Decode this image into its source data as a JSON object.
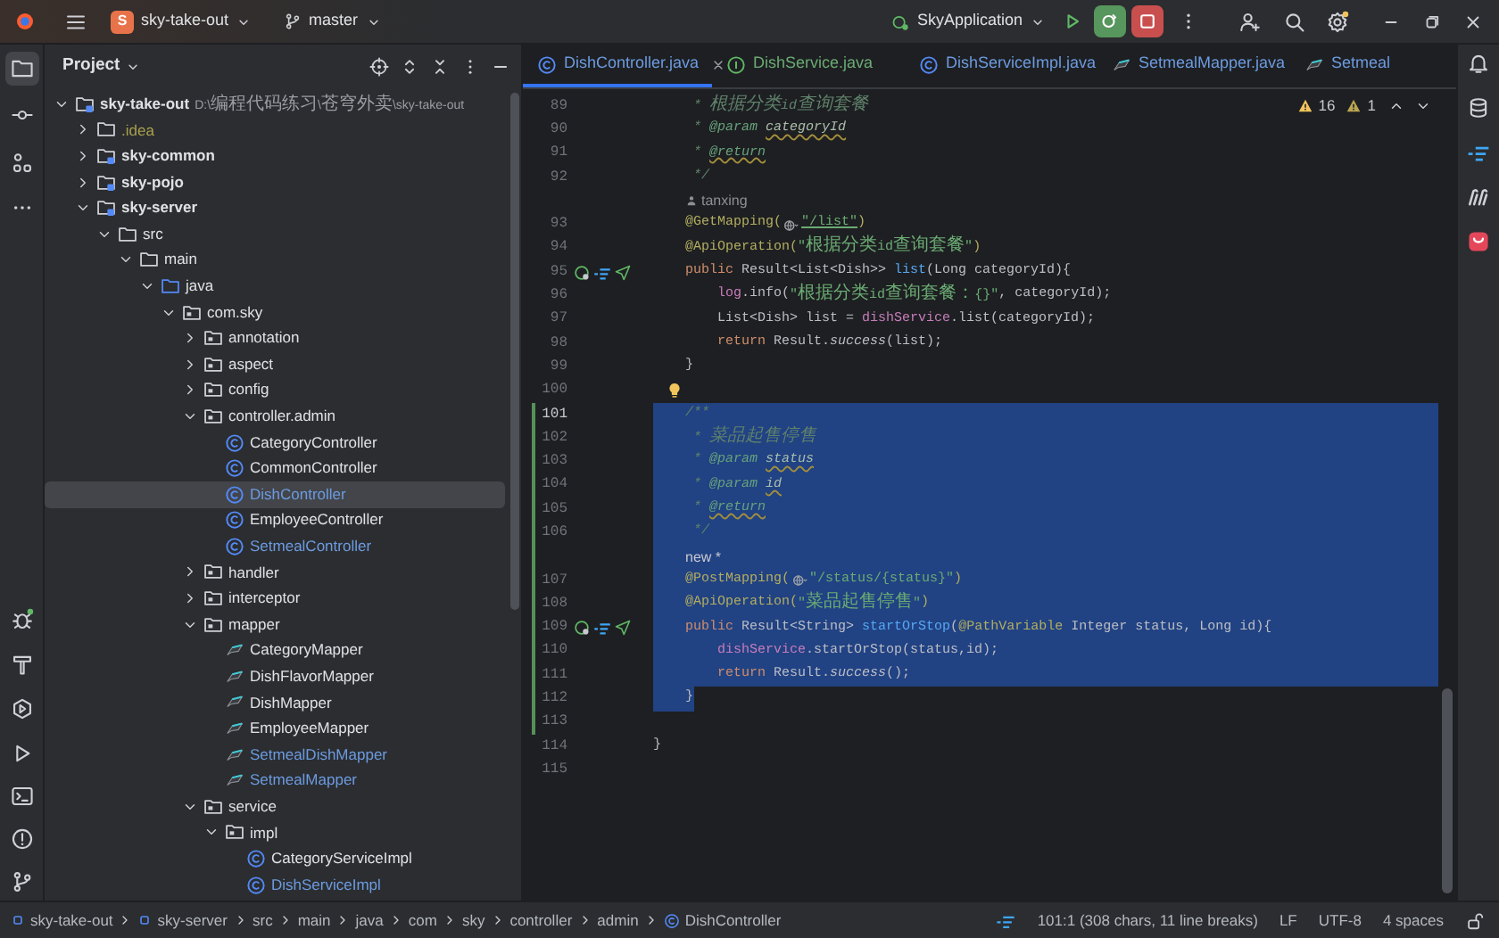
{
  "title_bar": {
    "project_initial": "S",
    "project_name": "sky-take-out",
    "branch": "master",
    "run_config": "SkyApplication"
  },
  "tool_strip": {
    "project_selected": true
  },
  "project_panel": {
    "title": "Project"
  },
  "project_tree": [
    {
      "label": "sky-take-out",
      "path": "D:\\编程代码练习\\苍穹外卖\\sky-take-out",
      "kind": "module",
      "color": "#dfe1e5",
      "expanded": true,
      "selected": false,
      "children": [
        {
          "label": ".idea",
          "kind": "folder",
          "color": "#a9a14d",
          "expanded": false,
          "selected": false
        },
        {
          "label": "sky-common",
          "kind": "module",
          "color": "#dfe1e5",
          "expanded": false,
          "selected": false
        },
        {
          "label": "sky-pojo",
          "kind": "module",
          "color": "#dfe1e5",
          "expanded": false,
          "selected": false
        },
        {
          "label": "sky-server",
          "kind": "module",
          "color": "#dfe1e5",
          "expanded": true,
          "selected": false,
          "children": [
            {
              "label": "src",
              "kind": "folder",
              "color": "#dfe1e5",
              "expanded": true,
              "selected": false,
              "children": [
                {
                  "label": "main",
                  "kind": "folder",
                  "color": "#dfe1e5",
                  "expanded": true,
                  "selected": false,
                  "children": [
                    {
                      "label": "java",
                      "kind": "source_folder",
                      "color": "#dfe1e5",
                      "expanded": true,
                      "selected": false,
                      "children": [
                        {
                          "label": "com.sky",
                          "kind": "package",
                          "color": "#dfe1e5",
                          "expanded": true,
                          "selected": false,
                          "children": [
                            {
                              "label": "annotation",
                              "kind": "package",
                              "color": "#dfe1e5",
                              "expanded": false,
                              "selected": false
                            },
                            {
                              "label": "aspect",
                              "kind": "package",
                              "color": "#dfe1e5",
                              "expanded": false,
                              "selected": false
                            },
                            {
                              "label": "config",
                              "kind": "package",
                              "color": "#dfe1e5",
                              "expanded": false,
                              "selected": false
                            },
                            {
                              "label": "controller.admin",
                              "kind": "package",
                              "color": "#dfe1e5",
                              "expanded": true,
                              "selected": false,
                              "children": [
                                {
                                  "label": "CategoryController",
                                  "kind": "class",
                                  "color": "#dfe1e5",
                                  "selected": false
                                },
                                {
                                  "label": "CommonController",
                                  "kind": "class",
                                  "color": "#dfe1e5",
                                  "selected": false
                                },
                                {
                                  "label": "DishController",
                                  "kind": "class",
                                  "color": "#6c9be0",
                                  "selected": true
                                },
                                {
                                  "label": "EmployeeController",
                                  "kind": "class",
                                  "color": "#dfe1e5",
                                  "selected": false
                                },
                                {
                                  "label": "SetmealController",
                                  "kind": "class",
                                  "color": "#6c9be0",
                                  "selected": false
                                }
                              ]
                            },
                            {
                              "label": "handler",
                              "kind": "package",
                              "color": "#dfe1e5",
                              "expanded": false,
                              "selected": false
                            },
                            {
                              "label": "interceptor",
                              "kind": "package",
                              "color": "#dfe1e5",
                              "expanded": false,
                              "selected": false
                            },
                            {
                              "label": "mapper",
                              "kind": "package",
                              "color": "#dfe1e5",
                              "expanded": true,
                              "selected": false,
                              "children": [
                                {
                                  "label": "CategoryMapper",
                                  "kind": "mapper",
                                  "color": "#dfe1e5",
                                  "selected": false
                                },
                                {
                                  "label": "DishFlavorMapper",
                                  "kind": "mapper",
                                  "color": "#dfe1e5",
                                  "selected": false
                                },
                                {
                                  "label": "DishMapper",
                                  "kind": "mapper",
                                  "color": "#dfe1e5",
                                  "selected": false
                                },
                                {
                                  "label": "EmployeeMapper",
                                  "kind": "mapper",
                                  "color": "#dfe1e5",
                                  "selected": false
                                },
                                {
                                  "label": "SetmealDishMapper",
                                  "kind": "mapper",
                                  "color": "#6c9be0",
                                  "selected": false
                                },
                                {
                                  "label": "SetmealMapper",
                                  "kind": "mapper",
                                  "color": "#6c9be0",
                                  "selected": false
                                }
                              ]
                            },
                            {
                              "label": "service",
                              "kind": "package",
                              "color": "#dfe1e5",
                              "expanded": true,
                              "selected": false,
                              "children": [
                                {
                                  "label": "impl",
                                  "kind": "package",
                                  "color": "#dfe1e5",
                                  "expanded": true,
                                  "selected": false,
                                  "children": [
                                    {
                                      "label": "CategoryServiceImpl",
                                      "kind": "class",
                                      "color": "#dfe1e5",
                                      "selected": false
                                    },
                                    {
                                      "label": "DishServiceImpl",
                                      "kind": "class",
                                      "color": "#6c9be0",
                                      "selected": false
                                    }
                                  ]
                                }
                              ]
                            }
                          ]
                        }
                      ]
                    }
                  ]
                }
              ]
            }
          ]
        }
      ]
    }
  ],
  "tabs": [
    {
      "label": "DishController.java",
      "kind": "class",
      "color": "#6c9be0",
      "selected": true
    },
    {
      "label": "DishService.java",
      "kind": "interface",
      "color": "#6aab73",
      "selected": false
    },
    {
      "label": "DishServiceImpl.java",
      "kind": "class",
      "color": "#6c9be0",
      "selected": false
    },
    {
      "label": "SetmealMapper.java",
      "kind": "mapper",
      "color": "#6c9be0",
      "selected": false
    },
    {
      "label": "Setmeal",
      "kind": "mapper",
      "color": "#6c9be0",
      "selected": false
    }
  ],
  "inspections": {
    "warnings": "16",
    "weak_warnings": "1"
  },
  "lines": [
    {
      "kind": "code",
      "number": "89",
      "changed": false,
      "selected": false,
      "eol_selected": false,
      "tokens": [
        {
          "text": "     * 根据分类id查询套餐",
          "kind": "doc"
        }
      ]
    },
    {
      "kind": "code",
      "number": "90",
      "changed": false,
      "selected": false,
      "eol_selected": false,
      "tokens": [
        {
          "text": "     * ",
          "kind": "doc"
        },
        {
          "text": "@param ",
          "kind": "doc_tag"
        },
        {
          "text": "categoryId",
          "kind": "doc_ref_warned"
        }
      ]
    },
    {
      "kind": "code",
      "number": "91",
      "changed": false,
      "selected": false,
      "eol_selected": false,
      "tokens": [
        {
          "text": "     * ",
          "kind": "doc"
        },
        {
          "text": "@return",
          "kind": "doc_tag_warned"
        }
      ]
    },
    {
      "kind": "code",
      "number": "92",
      "changed": false,
      "selected": false,
      "eol_selected": false,
      "tokens": [
        {
          "text": "     */",
          "kind": "doc"
        }
      ]
    },
    {
      "kind": "author_hint",
      "text": "tanxing",
      "changed": false,
      "selected": false
    },
    {
      "kind": "code",
      "number": "93",
      "changed": false,
      "selected": false,
      "eol_selected": false,
      "tokens": [
        {
          "text": "    @GetMapping(",
          "kind": "annotation"
        },
        {
          "kind": "web_icon"
        },
        {
          "text": "\"/list\"",
          "kind": "string_link"
        },
        {
          "text": ")",
          "kind": "annotation"
        }
      ]
    },
    {
      "kind": "code",
      "number": "94",
      "changed": false,
      "selected": false,
      "eol_selected": false,
      "tokens": [
        {
          "text": "    @ApiOperation(",
          "kind": "annotation"
        },
        {
          "text": "\"根据分类id查询套餐\"",
          "kind": "string"
        },
        {
          "text": ")",
          "kind": "annotation"
        }
      ]
    },
    {
      "kind": "mapping_method",
      "number": "95",
      "changed": false,
      "selected": false,
      "eol_selected": false,
      "tokens": [
        {
          "text": "    public ",
          "kind": "keyword"
        },
        {
          "text": "Result<List<Dish>> ",
          "kind": "plain"
        },
        {
          "text": "list",
          "kind": "method"
        },
        {
          "text": "(Long categoryId){",
          "kind": "plain"
        }
      ]
    },
    {
      "kind": "code",
      "number": "96",
      "changed": false,
      "selected": false,
      "eol_selected": false,
      "tokens": [
        {
          "text": "        log",
          "kind": "field"
        },
        {
          "text": ".info(",
          "kind": "plain"
        },
        {
          "text": "\"根据分类id查询套餐：{}\"",
          "kind": "string"
        },
        {
          "text": ", categoryId);",
          "kind": "plain"
        }
      ]
    },
    {
      "kind": "code",
      "number": "97",
      "changed": false,
      "selected": false,
      "eol_selected": false,
      "tokens": [
        {
          "text": "        List<Dish> list = ",
          "kind": "plain"
        },
        {
          "text": "dishService",
          "kind": "field"
        },
        {
          "text": ".list(categoryId);",
          "kind": "plain"
        }
      ]
    },
    {
      "kind": "code",
      "number": "98",
      "changed": false,
      "selected": false,
      "eol_selected": false,
      "tokens": [
        {
          "text": "        return ",
          "kind": "keyword"
        },
        {
          "text": "Result.",
          "kind": "plain"
        },
        {
          "text": "success",
          "kind": "static"
        },
        {
          "text": "(list);",
          "kind": "plain"
        }
      ]
    },
    {
      "kind": "code",
      "number": "99",
      "changed": false,
      "selected": false,
      "eol_selected": false,
      "tokens": [
        {
          "text": "    }",
          "kind": "plain"
        }
      ]
    },
    {
      "kind": "intention",
      "number": "100",
      "changed": false,
      "selected": false,
      "eol_selected": false
    },
    {
      "kind": "code",
      "number": "101",
      "changed": true,
      "selected": true,
      "eol_selected": true,
      "tokens": [
        {
          "text": "    /**",
          "kind": "doc"
        }
      ]
    },
    {
      "kind": "code",
      "number": "102",
      "changed": true,
      "selected": true,
      "eol_selected": true,
      "tokens": [
        {
          "text": "     * 菜品起售停售",
          "kind": "doc"
        }
      ]
    },
    {
      "kind": "code",
      "number": "103",
      "changed": true,
      "selected": true,
      "eol_selected": true,
      "tokens": [
        {
          "text": "     * ",
          "kind": "doc"
        },
        {
          "text": "@param ",
          "kind": "doc_tag"
        },
        {
          "text": "status",
          "kind": "doc_ref_warned"
        }
      ]
    },
    {
      "kind": "code",
      "number": "104",
      "changed": true,
      "selected": true,
      "eol_selected": true,
      "tokens": [
        {
          "text": "     * ",
          "kind": "doc"
        },
        {
          "text": "@param ",
          "kind": "doc_tag"
        },
        {
          "text": "id",
          "kind": "doc_ref_warned"
        }
      ]
    },
    {
      "kind": "code",
      "number": "105",
      "changed": true,
      "selected": true,
      "eol_selected": true,
      "tokens": [
        {
          "text": "     * ",
          "kind": "doc"
        },
        {
          "text": "@return",
          "kind": "doc_tag_warned"
        }
      ]
    },
    {
      "kind": "code",
      "number": "106",
      "changed": true,
      "selected": true,
      "eol_selected": true,
      "tokens": [
        {
          "text": "     */",
          "kind": "doc"
        }
      ]
    },
    {
      "kind": "change_hint",
      "text": "new *",
      "changed": true,
      "selected": true
    },
    {
      "kind": "code",
      "number": "107",
      "changed": true,
      "selected": true,
      "eol_selected": true,
      "tokens": [
        {
          "text": "    @PostMapping(",
          "kind": "annotation"
        },
        {
          "kind": "web_icon"
        },
        {
          "text": "\"/status/{status}\"",
          "kind": "string"
        },
        {
          "text": ")",
          "kind": "annotation"
        }
      ]
    },
    {
      "kind": "code",
      "number": "108",
      "changed": true,
      "selected": true,
      "eol_selected": true,
      "tokens": [
        {
          "text": "    @ApiOperation(",
          "kind": "annotation"
        },
        {
          "text": "\"菜品起售停售\"",
          "kind": "string"
        },
        {
          "text": ")",
          "kind": "annotation"
        }
      ]
    },
    {
      "kind": "mapping_method",
      "number": "109",
      "changed": true,
      "selected": true,
      "eol_selected": true,
      "tokens": [
        {
          "text": "    public ",
          "kind": "keyword"
        },
        {
          "text": "Result<String> ",
          "kind": "plain"
        },
        {
          "text": "startOrStop",
          "kind": "method"
        },
        {
          "text": "(",
          "kind": "plain"
        },
        {
          "text": "@PathVariable",
          "kind": "annotation"
        },
        {
          "text": " Integer status, Long id){",
          "kind": "plain"
        }
      ]
    },
    {
      "kind": "code",
      "number": "110",
      "changed": true,
      "selected": true,
      "eol_selected": true,
      "tokens": [
        {
          "text": "        dishService",
          "kind": "field"
        },
        {
          "text": ".startOrStop(status,id);",
          "kind": "plain"
        }
      ]
    },
    {
      "kind": "code",
      "number": "111",
      "changed": true,
      "selected": true,
      "eol_selected": true,
      "tokens": [
        {
          "text": "        return ",
          "kind": "keyword"
        },
        {
          "text": "Result.",
          "kind": "plain"
        },
        {
          "text": "success",
          "kind": "static"
        },
        {
          "text": "();",
          "kind": "plain"
        }
      ]
    },
    {
      "kind": "code",
      "number": "112",
      "changed": true,
      "selected": true,
      "eol_selected": false,
      "tokens": [
        {
          "text": "    }",
          "kind": "plain"
        }
      ]
    },
    {
      "kind": "code",
      "number": "113",
      "changed": true,
      "selected": false,
      "eol_selected": false
    },
    {
      "kind": "code",
      "number": "114",
      "changed": false,
      "selected": false,
      "eol_selected": false,
      "tokens": [
        {
          "text": "}",
          "kind": "plain"
        }
      ]
    },
    {
      "kind": "code",
      "number": "115",
      "changed": false,
      "selected": false,
      "eol_selected": false
    }
  ],
  "breadcrumbs": [
    {
      "label": "sky-take-out",
      "kind": "module"
    },
    {
      "label": "sky-server",
      "kind": "module"
    },
    {
      "label": "src",
      "kind": "plain"
    },
    {
      "label": "main",
      "kind": "plain"
    },
    {
      "label": "java",
      "kind": "plain"
    },
    {
      "label": "com",
      "kind": "plain"
    },
    {
      "label": "sky",
      "kind": "plain"
    },
    {
      "label": "controller",
      "kind": "plain"
    },
    {
      "label": "admin",
      "kind": "plain"
    },
    {
      "label": "DishController",
      "kind": "class"
    }
  ],
  "status_bar": {
    "position": "101:1 (308 chars, 11 line breaks)",
    "line_separator": "LF",
    "encoding": "UTF-8",
    "indent": "4 spaces"
  }
}
